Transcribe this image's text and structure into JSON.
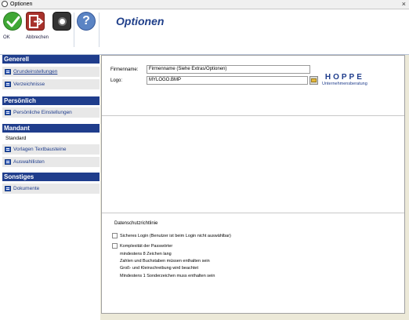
{
  "window": {
    "title": "Optionen",
    "close_label": "×"
  },
  "toolbar": {
    "ok_label": "OK",
    "cancel_label": "Abbrechen",
    "camera_icon": "camera-icon",
    "help_glyph": "?"
  },
  "page_title": "Optionen",
  "sidebar": {
    "sections": [
      {
        "title": "Generell",
        "items": [
          "Grundeinstellungen",
          "Verzeichnisse"
        ]
      },
      {
        "title": "Persönlich",
        "items": [
          "Persönliche Einstellungen"
        ]
      },
      {
        "title": "Mandant",
        "plain_item": "Standard",
        "items": [
          "Vorlagen Textbausteine",
          "Auswahllisten"
        ]
      },
      {
        "title": "Sonstiges",
        "items": [
          "Dokumente"
        ]
      }
    ]
  },
  "form": {
    "firmenname_label": "Firmenname:",
    "firmenname_value": "Firmenname (Siehe Extras/Optionen)",
    "logo_label": "Logo:",
    "logo_value": "MYLOGO.BMP"
  },
  "logo_preview": {
    "brand": "HOPPE",
    "tagline": "Unternehmensberatung"
  },
  "datenschutz": {
    "title": "Datenschutzrichtlinie",
    "checkbox1": "Sicheres Login (Benutzer ist beim Login nicht auswählbar)",
    "checkbox2": "Komplexität der Passwörter",
    "rules": [
      "mindestens 8 Zeichen lang",
      "Zahlen und Buchstaben müssen enthalten sein",
      "Groß- und Kleinschreibung wird beachtet",
      "Mindestens 1 Sonderzeichen muss enthalten sein"
    ]
  },
  "colors": {
    "accent": "#1f3d8c",
    "title": "#1f3f8a",
    "ok": "#3fa735",
    "cancel": "#a8322c"
  }
}
